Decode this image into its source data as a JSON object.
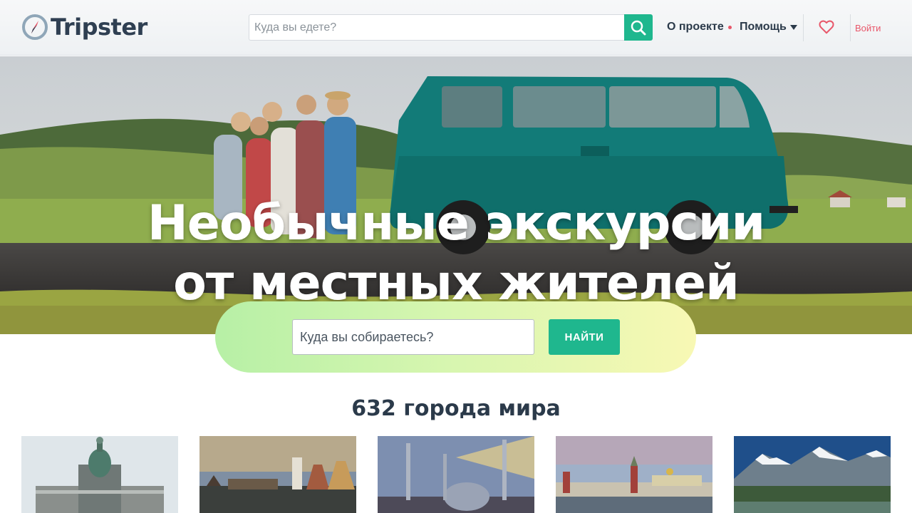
{
  "header": {
    "logo_text": "Tripster",
    "search_placeholder": "Куда вы едете?",
    "nav_about": "О проекте",
    "nav_help": "Помощь",
    "login": "Войти"
  },
  "hero": {
    "title_line1": "Необычные экскурсии",
    "title_line2": "от местных жителей",
    "search_placeholder": "Куда вы собираетесь?",
    "find_button": "НАЙТИ"
  },
  "cities": {
    "title": "632 города мира"
  },
  "colors": {
    "accent": "#1fb78e",
    "login": "#e8576a",
    "text": "#2b3a4a"
  }
}
